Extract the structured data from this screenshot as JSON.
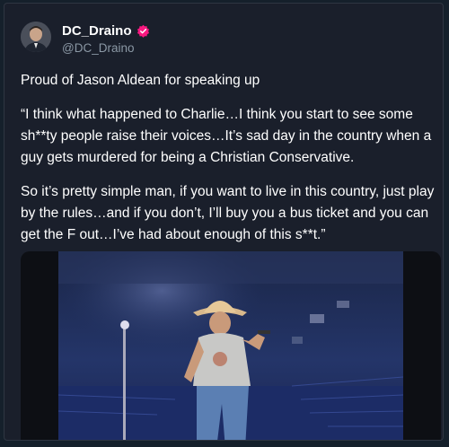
{
  "author": {
    "display_name": "DC_Draino",
    "handle": "@DC_Draino",
    "verified_icon": "verified-badge-icon",
    "verified_color": "#f91880",
    "avatar_icon": "profile-avatar"
  },
  "post": {
    "paragraphs": [
      "Proud of Jason Aldean for speaking up",
      "“I think what happened to Charlie…I think you start to see some sh**ty people raise their voices…It’s sad day in the country when a guy gets murdered for being a Christian Conservative.",
      "So it’s pretty simple man, if you want to live in this country, just play by the rules…and if you don’t, I’ll buy you a bus ticket and you can get the F out…I’ve had about enough of this s**t.”"
    ]
  },
  "media": {
    "type": "video",
    "description_icon": "concert-video-thumbnail"
  },
  "colors": {
    "background": "#1a1f2b",
    "text": "#ffffff",
    "secondary_text": "#8b98a5"
  }
}
